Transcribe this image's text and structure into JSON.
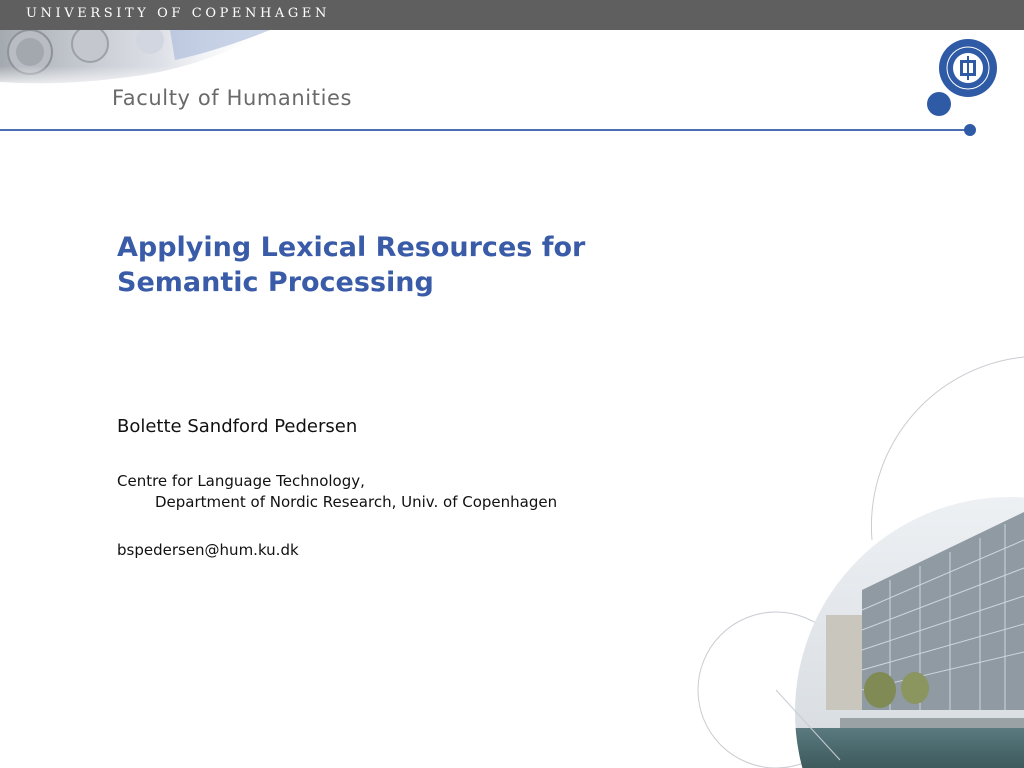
{
  "header": {
    "university": "UNIVERSITY OF COPENHAGEN",
    "faculty": "Faculty of Humanities"
  },
  "slide": {
    "title_line1": "Applying Lexical Resources for",
    "title_line2": "Semantic Processing",
    "author": "Bolette Sandford Pedersen",
    "affiliation_line1": "Centre for Language Technology,",
    "affiliation_line2": "Department of Nordic Research, Univ. of Copenhagen",
    "email": "bspedersen@hum.ku.dk"
  },
  "colors": {
    "topbar": "#5f5f5f",
    "accent_blue": "#2f5ba6",
    "title_blue": "#3a5ca8"
  }
}
